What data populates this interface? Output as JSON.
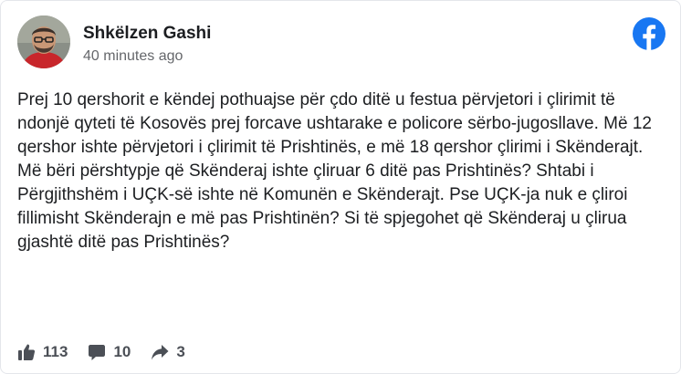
{
  "post": {
    "author": "Shkëlzen Gashi",
    "time": "40 minutes ago",
    "text": "Prej 10 qershorit e këndej pothuajse për çdo ditë u festua përvjetori i çlirimit të ndonjë qyteti të Kosovës prej forcave ushtarake e policore sërbo-jugosllave. Më 12 qershor ishte përvjetori i çlirimit të Prishtinës, e më 18 qershor çlirimi i Skënderajt. Më bëri përshtypje që Skënderaj ishte çliruar 6 ditë pas Prishtinës? Shtabi i Përgjithshëm i UÇK-së ishte në Komunën e Skënderajt. Pse UÇK-ja nuk e çliroi fillimisht Skënderajn e më pas Prishtinën? Si të spjegohet që Skënderaj u çlirua gjashtë ditë pas Prishtinës?"
  },
  "stats": {
    "likes": "113",
    "comments": "10",
    "shares": "3"
  },
  "icons": {
    "platform": "facebook-icon",
    "like": "thumbs-up-icon",
    "comment": "comment-icon",
    "share": "share-icon"
  },
  "colors": {
    "facebook_blue": "#1877f2",
    "icon_gray": "#4b4f56",
    "secondary_text": "#65676b"
  }
}
